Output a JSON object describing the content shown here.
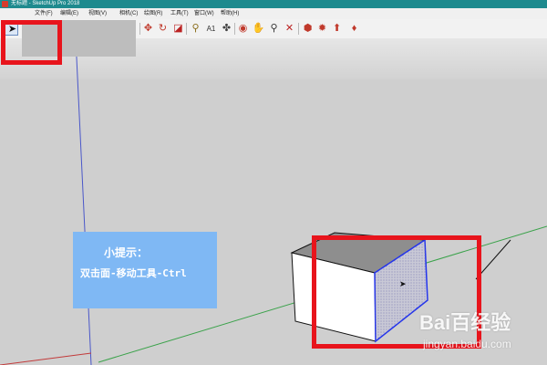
{
  "window": {
    "title": "无标题 - SketchUp Pro 2018",
    "accent": "#1e8a8e"
  },
  "menubar": {
    "items": [
      {
        "label": "文件(F)"
      },
      {
        "label": "编辑(E)"
      },
      {
        "label": "视图(V)"
      },
      {
        "label": "相机(C)"
      },
      {
        "label": "绘图(R)"
      },
      {
        "label": "工具(T)"
      },
      {
        "label": "窗口(W)"
      },
      {
        "label": "帮助(H)"
      }
    ]
  },
  "toolbar": {
    "tools": [
      {
        "name": "select-tool-button",
        "icon": "arrow-icon",
        "selected": true
      },
      {
        "name": "eraser-tool-button",
        "icon": "eraser-icon",
        "selected": false
      },
      {
        "name": "pencil-tool-button",
        "icon": "pencil-icon",
        "selected": false
      },
      {
        "name": "circle-tool-button",
        "icon": "circle-icon",
        "selected": false
      },
      {
        "name": "push-pull-tool-button",
        "icon": "push-pull-icon",
        "selected": false
      },
      {
        "name": "move-tool-button",
        "icon": "move-icon",
        "selected": false
      },
      {
        "name": "rotate-tool-button",
        "icon": "rotate-icon",
        "selected": false
      },
      {
        "name": "tape-measure-tool-button",
        "icon": "tape-measure-icon",
        "selected": false
      },
      {
        "name": "text-tool-button",
        "icon": "text-icon",
        "selected": false
      },
      {
        "name": "paint-bucket-tool-button",
        "icon": "paint-bucket-icon",
        "selected": false
      },
      {
        "name": "orbit-tool-button",
        "icon": "orbit-icon",
        "selected": false
      },
      {
        "name": "pan-tool-button",
        "icon": "pan-icon",
        "selected": false
      },
      {
        "name": "zoom-tool-button",
        "icon": "zoom-icon",
        "selected": false
      },
      {
        "name": "zoom-extents-tool-button",
        "icon": "zoom-extents-icon",
        "selected": false
      },
      {
        "name": "3d-warehouse-button",
        "icon": "warehouse-icon",
        "selected": false
      },
      {
        "name": "extension-warehouse-button",
        "icon": "extension-icon",
        "selected": false
      },
      {
        "name": "share-model-button",
        "icon": "share-icon",
        "selected": false
      },
      {
        "name": "ruby-console-button",
        "icon": "ruby-icon",
        "selected": false
      }
    ]
  },
  "tip": {
    "title": "小提示：",
    "text": "双击面-移动工具-Ctrl",
    "background": "#7fb8f4"
  },
  "highlight_color": "#e8141c",
  "watermark": {
    "brand": "Bai百经验",
    "site": "jingyan.baidu.com"
  }
}
